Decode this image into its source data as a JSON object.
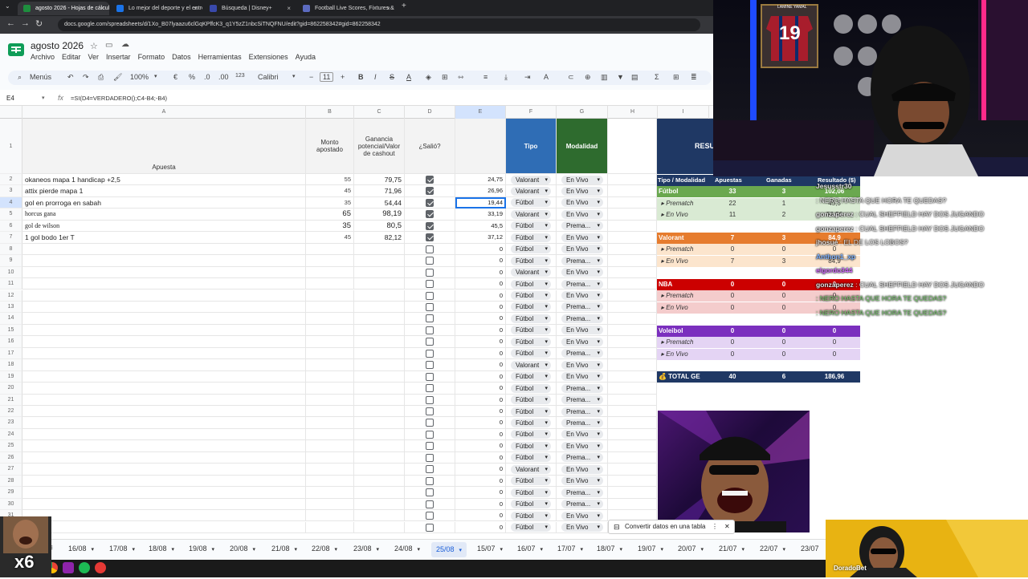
{
  "browser": {
    "tabs": [
      {
        "title": "agosto 2026 - Hojas de cálculo",
        "color": "#1e8e3e",
        "active": true
      },
      {
        "title": "Lo mejor del deporte y el entre",
        "color": "#1a73e8"
      },
      {
        "title": "Búsqueda | Disney+",
        "color": "#3949ab"
      },
      {
        "title": "Football Live Scores, Fixtures &",
        "color": "#5c6bc0"
      }
    ],
    "url": "docs.google.com/spreadsheets/d/1Xo_B07lyaazu6clGqKPffcK3_q1Y5zZ1nbcSiTNQFNU/edit?gid=862258342#gid=862258342"
  },
  "sheets": {
    "doc_title": "agosto 2026",
    "menu": [
      "Archivo",
      "Editar",
      "Ver",
      "Insertar",
      "Formato",
      "Datos",
      "Herramientas",
      "Extensiones",
      "Ayuda"
    ],
    "toolbar": {
      "search": "Menús",
      "zoom": "100%",
      "euro": "€",
      "percent": "%",
      "dec_less": ".0",
      "dec_more": ".00",
      "fmt": "123",
      "font": "Calibri",
      "size": "11"
    },
    "cell_ref": "E4",
    "formula": "=SI(D4=VERDADERO();C4-B4;-B4)",
    "columns": [
      "A",
      "B",
      "C",
      "D",
      "E",
      "F",
      "G",
      "H",
      "I"
    ],
    "header": {
      "a": "Apuesta",
      "b": "Monto apostado",
      "c": "Ganancia potencial/Valor de cashout",
      "d": "¿Salió?",
      "f": "Tipo",
      "g": "Modalidad"
    },
    "rows": [
      {
        "n": "2",
        "a": "okaneos mapa 1 handicap +2,5",
        "b": "55",
        "c": "79,75",
        "d": true,
        "e": "24,75",
        "f": "Valorant",
        "g": "En Vivo"
      },
      {
        "n": "3",
        "a": "attix pierde mapa 1",
        "b": "45",
        "c": "71,96",
        "d": true,
        "e": "26,96",
        "f": "Valorant",
        "g": "En Vivo"
      },
      {
        "n": "4",
        "a": "gol en prorroga en sabah",
        "b": "35",
        "c": "54,44",
        "d": true,
        "e": "19,44",
        "f": "Fútbol",
        "g": "En Vivo"
      },
      {
        "n": "5",
        "a": "horcus gana",
        "b": "65",
        "c": "98,19",
        "d": true,
        "e": "33,19",
        "f": "Valorant",
        "g": "En Vivo"
      },
      {
        "n": "6",
        "a": "gol de wilson",
        "b": "35",
        "c": "80,5",
        "d": true,
        "e": "45,5",
        "f": "Fútbol",
        "g": "Prema..."
      },
      {
        "n": "7",
        "a": "1 gol bodo 1er T",
        "b": "45",
        "c": "82,12",
        "d": true,
        "e": "37,12",
        "f": "Fútbol",
        "g": "En Vivo"
      },
      {
        "n": "8",
        "e": "0",
        "f": "Fútbol",
        "g": "En Vivo"
      },
      {
        "n": "9",
        "e": "0",
        "f": "Fútbol",
        "g": "Prema..."
      },
      {
        "n": "10",
        "e": "0",
        "f": "Valorant",
        "g": "En Vivo"
      },
      {
        "n": "11",
        "e": "0",
        "f": "Fútbol",
        "g": "Prema..."
      },
      {
        "n": "12",
        "e": "0",
        "f": "Fútbol",
        "g": "En Vivo"
      },
      {
        "n": "13",
        "e": "0",
        "f": "Fútbol",
        "g": "Prema..."
      },
      {
        "n": "14",
        "e": "0",
        "f": "Fútbol",
        "g": "Prema..."
      },
      {
        "n": "15",
        "e": "0",
        "f": "Fútbol",
        "g": "En Vivo"
      },
      {
        "n": "16",
        "e": "0",
        "f": "Fútbol",
        "g": "En Vivo"
      },
      {
        "n": "17",
        "e": "0",
        "f": "Fútbol",
        "g": "Prema..."
      },
      {
        "n": "18",
        "e": "0",
        "f": "Valorant",
        "g": "En Vivo"
      },
      {
        "n": "19",
        "e": "0",
        "f": "Fútbol",
        "g": "En Vivo"
      },
      {
        "n": "20",
        "e": "0",
        "f": "Fútbol",
        "g": "Prema..."
      },
      {
        "n": "21",
        "e": "0",
        "f": "Fútbol",
        "g": "Prema..."
      },
      {
        "n": "22",
        "e": "0",
        "f": "Fútbol",
        "g": "Prema..."
      },
      {
        "n": "23",
        "e": "0",
        "f": "Fútbol",
        "g": "Prema..."
      },
      {
        "n": "24",
        "e": "0",
        "f": "Fútbol",
        "g": "En Vivo"
      },
      {
        "n": "25",
        "e": "0",
        "f": "Fútbol",
        "g": "En Vivo"
      },
      {
        "n": "26",
        "e": "0",
        "f": "Fútbol",
        "g": "Prema..."
      },
      {
        "n": "27",
        "e": "0",
        "f": "Valorant",
        "g": "En Vivo"
      },
      {
        "n": "28",
        "e": "0",
        "f": "Fútbol",
        "g": "En Vivo"
      },
      {
        "n": "29",
        "e": "0",
        "f": "Fútbol",
        "g": "Prema..."
      },
      {
        "n": "30",
        "e": "0",
        "f": "Fútbol",
        "g": "Prema..."
      },
      {
        "n": "31",
        "e": "0",
        "f": "Fútbol",
        "g": "En Vivo"
      },
      {
        "n": "32",
        "e": "0",
        "f": "Fútbol",
        "g": "En Vivo"
      }
    ],
    "summary": {
      "title": "RESU",
      "headers": [
        "Tipo / Modalidad",
        "Apuestas",
        "Ganadas",
        "Resultado ($)"
      ],
      "rows": [
        {
          "label": "Fútbol",
          "a": "33",
          "g": "3",
          "r": "102,06",
          "kind": "cat",
          "bg": "#6aa84f",
          "fg": "#ffffff"
        },
        {
          "label": "▸ Prematch",
          "a": "22",
          "g": "1",
          "r": "45,5",
          "kind": "sub",
          "bg": "#d9ead3"
        },
        {
          "label": "▸ En Vivo",
          "a": "11",
          "g": "2",
          "r": "56,56",
          "kind": "sub",
          "bg": "#d9ead3"
        },
        {
          "label": "Valorant",
          "a": "7",
          "g": "3",
          "r": "84,9",
          "kind": "cat",
          "bg": "#e67c2e",
          "fg": "#ffffff"
        },
        {
          "label": "▸ Prematch",
          "a": "0",
          "g": "0",
          "r": "0",
          "kind": "sub",
          "bg": "#fce5cd"
        },
        {
          "label": "▸ En Vivo",
          "a": "7",
          "g": "3",
          "r": "84,9",
          "kind": "sub",
          "bg": "#fce5cd"
        },
        {
          "label": "NBA",
          "a": "0",
          "g": "0",
          "r": "0",
          "kind": "cat",
          "bg": "#cc0000",
          "fg": "#ffffff"
        },
        {
          "label": "▸ Prematch",
          "a": "0",
          "g": "0",
          "r": "0",
          "kind": "sub",
          "bg": "#f4cccc"
        },
        {
          "label": "▸ En Vivo",
          "a": "0",
          "g": "0",
          "r": "0",
          "kind": "sub",
          "bg": "#f4cccc"
        },
        {
          "label": "Voleibol",
          "a": "0",
          "g": "0",
          "r": "0",
          "kind": "cat",
          "bg": "#7b2fbe",
          "fg": "#ffffff"
        },
        {
          "label": "▸ Prematch",
          "a": "0",
          "g": "0",
          "r": "0",
          "kind": "sub",
          "bg": "#e4d4f4"
        },
        {
          "label": "▸ En Vivo",
          "a": "0",
          "g": "0",
          "r": "0",
          "kind": "sub",
          "bg": "#e4d4f4"
        },
        {
          "label": "💰 TOTAL GE",
          "a": "40",
          "g": "6",
          "r": "186,96",
          "kind": "total",
          "bg": "#1f3864",
          "fg": "#ffffff"
        }
      ]
    },
    "toast": "Convertir datos en una tabla",
    "sheet_tabs": [
      "16/08",
      "17/08",
      "18/08",
      "19/08",
      "20/08",
      "21/08",
      "22/08",
      "23/08",
      "24/08",
      "25/08",
      "15/07",
      "16/07",
      "17/07",
      "18/07",
      "19/07",
      "20/07",
      "21/07",
      "22/07",
      "23/07"
    ],
    "active_sheet": "25/08"
  },
  "stream": {
    "jersey_name": "LAMINE YAMAL",
    "jersey_number": "19",
    "multiplier": "x6",
    "cam_label": "DoradoBet",
    "chat": [
      {
        "user": "Jesusstr30",
        "msg": "",
        "color": "#e6e6e6"
      },
      {
        "user": "",
        "msg": "NERO HASTA QUE HORA TE QUEDAS?",
        "color": "#e6e6e6"
      },
      {
        "user": "gonzaperez",
        "msg": "CUAL SHEFFIELD HAY DOS JUGANDO",
        "color": "#e6e6e6"
      },
      {
        "user": "gonzaperez",
        "msg": "CUAL SHEFFIELD HAY DOS JUGANDO",
        "color": "#e6e6e6"
      },
      {
        "user": "jhosue",
        "msg": "EL DE LOS LOBOS?",
        "color": "#e6e6e6"
      },
      {
        "user": "Anthon1_xp",
        "msg": "",
        "color": "#7fb3ff"
      },
      {
        "user": "elgordo344",
        "msg": "",
        "color": "#d36cff"
      },
      {
        "user": "gonzaperez",
        "msg": "CUAL SHEFFIELD HAY DOS JUGANDO",
        "color": "#e6e6e6"
      },
      {
        "user": "",
        "msg": "NERO HASTA QUE HORA TE QUEDAS?",
        "color": "#7bc96f"
      },
      {
        "user": "",
        "msg": "NERO HASTA QUE HORA TE QUEDAS?",
        "color": "#7bc96f"
      }
    ]
  }
}
